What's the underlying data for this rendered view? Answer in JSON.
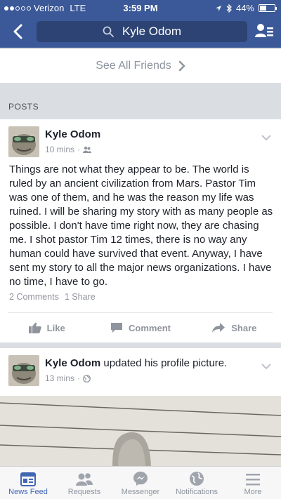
{
  "status_bar": {
    "carrier": "Verizon",
    "network": "LTE",
    "time": "3:59 PM",
    "battery_text": "44%",
    "battery_level": 0.44
  },
  "nav": {
    "search_value": "Kyle Odom"
  },
  "friends": {
    "see_all_label": "See All Friends"
  },
  "posts_section": {
    "label": "POSTS"
  },
  "posts": [
    {
      "author": "Kyle Odom",
      "action_text": "",
      "time": "10 mins",
      "audience_icon": "friends-icon",
      "text": "Things are not what they appear to be. The world is ruled by an ancient civilization from Mars. Pastor Tim was one of them, and he was the reason my life was ruined. I will be sharing my story with as many people as possible. I don't have time right now, they are chasing me. I shot pastor Tim 12 times, there is no way any human could have survived that event. Anyway, I have sent my story to all the major news organizations. I have no time, I have to go.",
      "comments": "2 Comments",
      "shares": "1 Share",
      "actions": {
        "like": "Like",
        "comment": "Comment",
        "share": "Share"
      }
    },
    {
      "author": "Kyle Odom",
      "action_text": "updated his profile picture.",
      "time": "13 mins",
      "audience_icon": "globe-icon"
    }
  ],
  "tabbar": [
    {
      "label": "News Feed",
      "icon": "news-feed-icon",
      "active": true
    },
    {
      "label": "Requests",
      "icon": "requests-icon",
      "active": false
    },
    {
      "label": "Messenger",
      "icon": "messenger-icon",
      "active": false
    },
    {
      "label": "Notifications",
      "icon": "globe-icon",
      "active": false
    },
    {
      "label": "More",
      "icon": "menu-icon",
      "active": false
    }
  ],
  "colors": {
    "brand": "#3b5998",
    "active_tab": "#4267b2",
    "muted": "#90949c"
  }
}
